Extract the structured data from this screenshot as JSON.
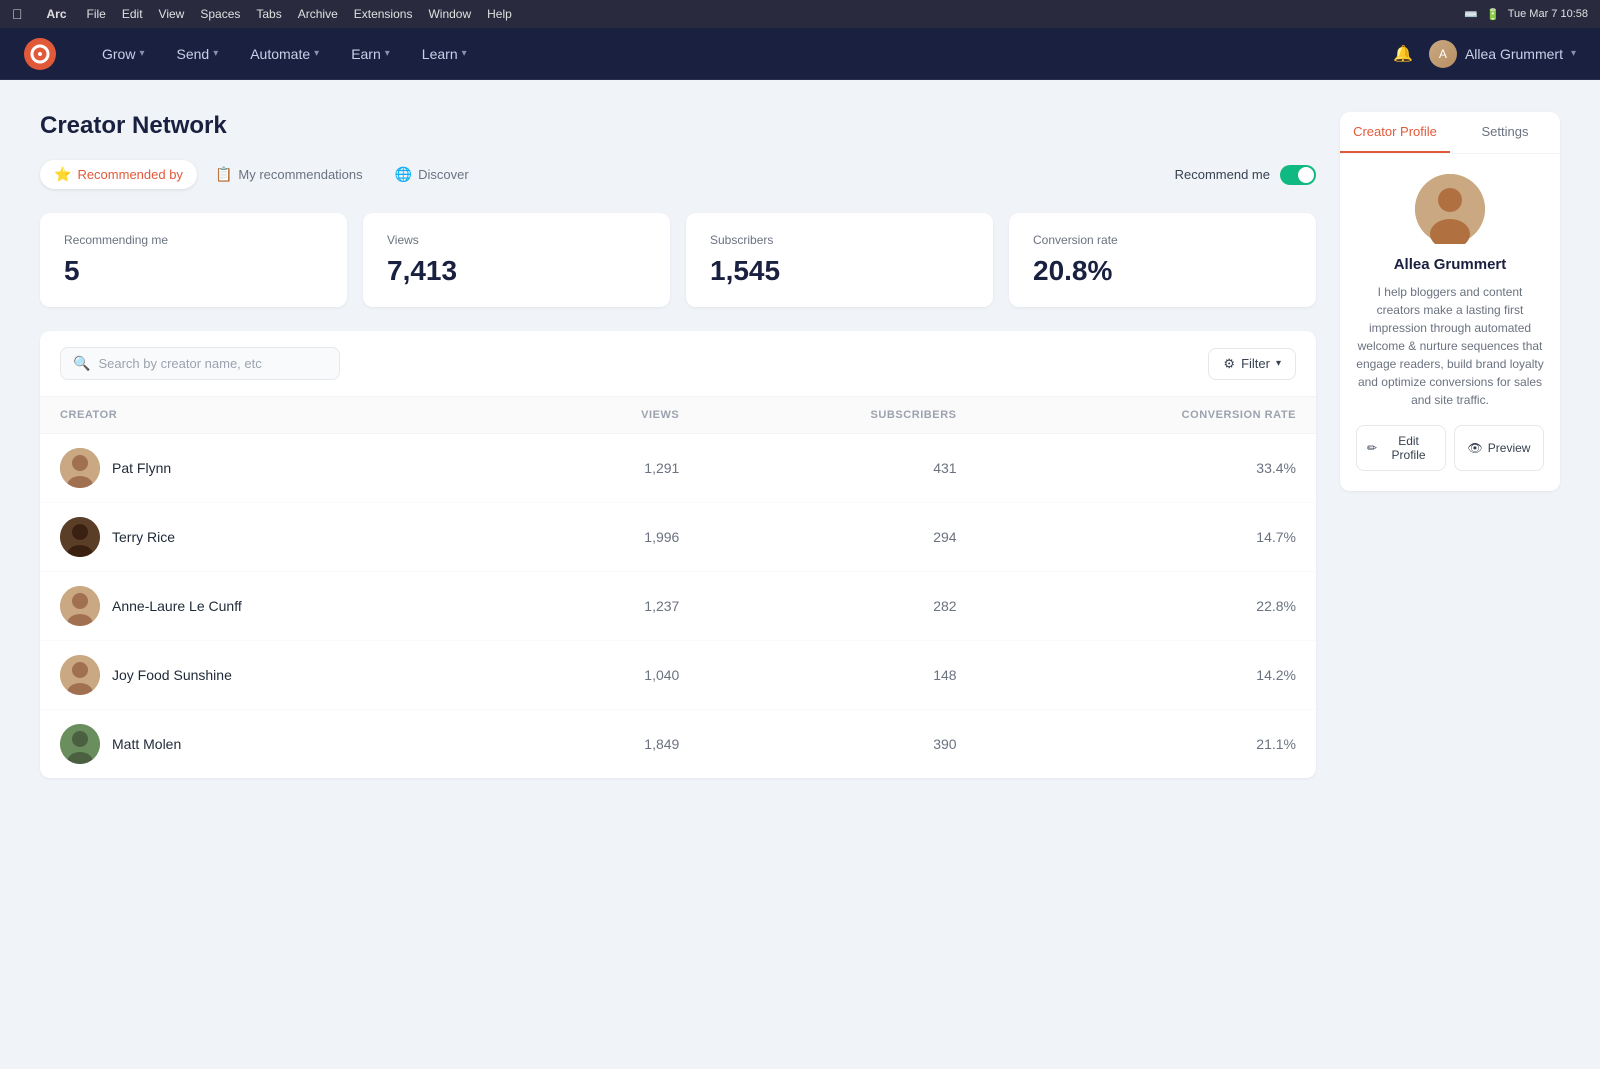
{
  "macMenubar": {
    "appName": "Arc",
    "menuItems": [
      "File",
      "Edit",
      "View",
      "Spaces",
      "Tabs",
      "Archive",
      "Extensions",
      "Window",
      "Help"
    ],
    "time": "Tue Mar 7  10:58"
  },
  "appNavbar": {
    "logoAlt": "ConvertKit logo",
    "navItems": [
      {
        "label": "Grow",
        "hasDropdown": true
      },
      {
        "label": "Send",
        "hasDropdown": true
      },
      {
        "label": "Automate",
        "hasDropdown": true
      },
      {
        "label": "Earn",
        "hasDropdown": true
      },
      {
        "label": "Learn",
        "hasDropdown": true
      }
    ],
    "userName": "Allea Grummert",
    "bellIcon": "🔔"
  },
  "page": {
    "title": "Creator Network",
    "subNavTabs": [
      {
        "label": "Recommended by",
        "icon": "⭐",
        "active": true
      },
      {
        "label": "My recommendations",
        "icon": "📋",
        "active": false
      },
      {
        "label": "Discover",
        "icon": "🌐",
        "active": false
      }
    ],
    "recommendToggleLabel": "Recommend me",
    "recommendToggleOn": true
  },
  "stats": [
    {
      "label": "Recommending me",
      "value": "5"
    },
    {
      "label": "Views",
      "value": "7,413"
    },
    {
      "label": "Subscribers",
      "value": "1,545"
    },
    {
      "label": "Conversion rate",
      "value": "20.8%"
    }
  ],
  "table": {
    "searchPlaceholder": "Search by creator name, etc",
    "filterLabel": "Filter",
    "columns": [
      {
        "key": "creator",
        "label": "CREATOR"
      },
      {
        "key": "views",
        "label": "VIEWS"
      },
      {
        "key": "subscribers",
        "label": "SUBSCRIBERS"
      },
      {
        "key": "conversionRate",
        "label": "CONVERSION RATE"
      }
    ],
    "rows": [
      {
        "name": "Pat Flynn",
        "views": "1,291",
        "subscribers": "431",
        "conversionRate": "33.4%",
        "avatarClass": "av-pat"
      },
      {
        "name": "Terry Rice",
        "views": "1,996",
        "subscribers": "294",
        "conversionRate": "14.7%",
        "avatarClass": "av-terry"
      },
      {
        "name": "Anne-Laure Le Cunff",
        "views": "1,237",
        "subscribers": "282",
        "conversionRate": "22.8%",
        "avatarClass": "av-anne"
      },
      {
        "name": "Joy Food Sunshine",
        "views": "1,040",
        "subscribers": "148",
        "conversionRate": "14.2%",
        "avatarClass": "av-joy"
      },
      {
        "name": "Matt Molen",
        "views": "1,849",
        "subscribers": "390",
        "conversionRate": "21.1%",
        "avatarClass": "av-matt"
      }
    ]
  },
  "creatorProfile": {
    "tabs": [
      {
        "label": "Creator Profile",
        "active": true
      },
      {
        "label": "Settings",
        "active": false
      }
    ],
    "name": "Allea Grummert",
    "bio": "I help bloggers and content creators make a lasting first impression through automated welcome & nurture sequences that engage readers, build brand loyalty and optimize conversions for sales and site traffic.",
    "editProfileLabel": "Edit Profile",
    "previewLabel": "Preview"
  }
}
